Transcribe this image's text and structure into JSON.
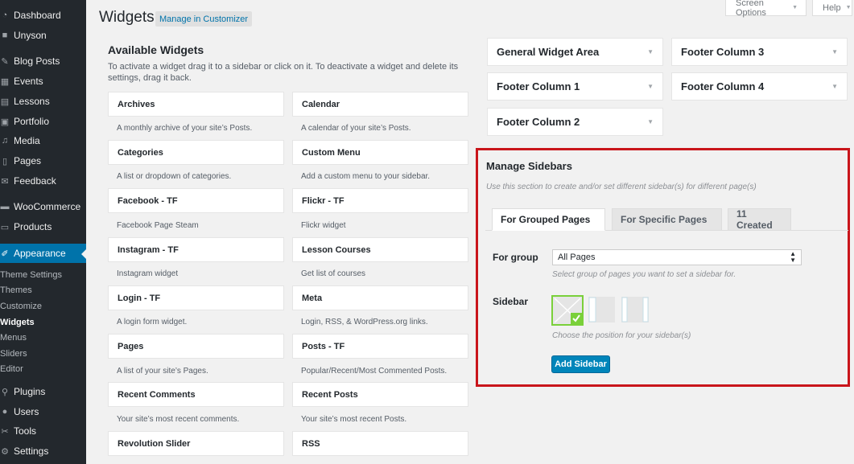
{
  "sidebar": {
    "items": [
      {
        "label": "Dashboard",
        "icon": "dashboard-icon"
      },
      {
        "label": "Unyson",
        "icon": "unyson-icon"
      },
      {
        "label": "Blog Posts",
        "icon": "pin-icon"
      },
      {
        "label": "Events",
        "icon": "events-icon"
      },
      {
        "label": "Lessons",
        "icon": "lessons-icon"
      },
      {
        "label": "Portfolio",
        "icon": "portfolio-icon"
      },
      {
        "label": "Media",
        "icon": "media-icon"
      },
      {
        "label": "Pages",
        "icon": "pages-icon"
      },
      {
        "label": "Feedback",
        "icon": "feedback-icon"
      },
      {
        "label": "WooCommerce",
        "icon": "woocommerce-icon"
      },
      {
        "label": "Products",
        "icon": "products-icon"
      },
      {
        "label": "Appearance",
        "icon": "appearance-icon"
      },
      {
        "label": "Plugins",
        "icon": "plugins-icon"
      },
      {
        "label": "Users",
        "icon": "users-icon"
      },
      {
        "label": "Tools",
        "icon": "tools-icon"
      },
      {
        "label": "Settings",
        "icon": "settings-icon"
      }
    ],
    "submenu": [
      "Theme Settings",
      "Themes",
      "Customize",
      "Widgets",
      "Menus",
      "Sliders",
      "Editor"
    ],
    "active_color": "#0073aa"
  },
  "header": {
    "title": "Widgets",
    "customizer_label": "Manage in Customizer",
    "screen_options": "Screen Options",
    "help": "Help"
  },
  "available": {
    "title": "Available Widgets",
    "description": "To activate a widget drag it to a sidebar or click on it. To deactivate a widget and delete its settings, drag it back.",
    "widgets": [
      {
        "name": "Archives",
        "desc": "A monthly archive of your site’s Posts."
      },
      {
        "name": "Calendar",
        "desc": "A calendar of your site’s Posts."
      },
      {
        "name": "Categories",
        "desc": "A list or dropdown of categories."
      },
      {
        "name": "Custom Menu",
        "desc": "Add a custom menu to your sidebar."
      },
      {
        "name": "Facebook - TF",
        "desc": "Facebook Page Steam"
      },
      {
        "name": "Flickr - TF",
        "desc": "Flickr widget"
      },
      {
        "name": "Instagram - TF",
        "desc": "Instagram widget"
      },
      {
        "name": "Lesson Courses",
        "desc": "Get list of courses"
      },
      {
        "name": "Login - TF",
        "desc": "A login form widget."
      },
      {
        "name": "Meta",
        "desc": "Login, RSS, & WordPress.org links."
      },
      {
        "name": "Pages",
        "desc": "A list of your site’s Pages."
      },
      {
        "name": "Posts - TF",
        "desc": "Popular/Recent/Most Commented Posts."
      },
      {
        "name": "Recent Comments",
        "desc": "Your site’s most recent comments."
      },
      {
        "name": "Recent Posts",
        "desc": "Your site’s most recent Posts."
      },
      {
        "name": "Revolution Slider",
        "desc": ""
      },
      {
        "name": "RSS",
        "desc": ""
      }
    ]
  },
  "areas": [
    "General Widget Area",
    "Footer Column 3",
    "Footer Column 1",
    "Footer Column 4",
    "Footer Column 2"
  ],
  "manage": {
    "title": "Manage Sidebars",
    "description": "Use this section to create and/or set different sidebar(s) for different page(s)",
    "tabs": [
      "For Grouped Pages",
      "For Specific Pages",
      "11 Created"
    ],
    "group_label": "For group",
    "group_value": "All Pages",
    "group_hint": "Select group of pages you want to set a sidebar for.",
    "sidebar_label": "Sidebar",
    "sidebar_hint": "Choose the position for your sidebar(s)",
    "add_button": "Add Sidebar",
    "highlight_color": "#c9151b"
  }
}
